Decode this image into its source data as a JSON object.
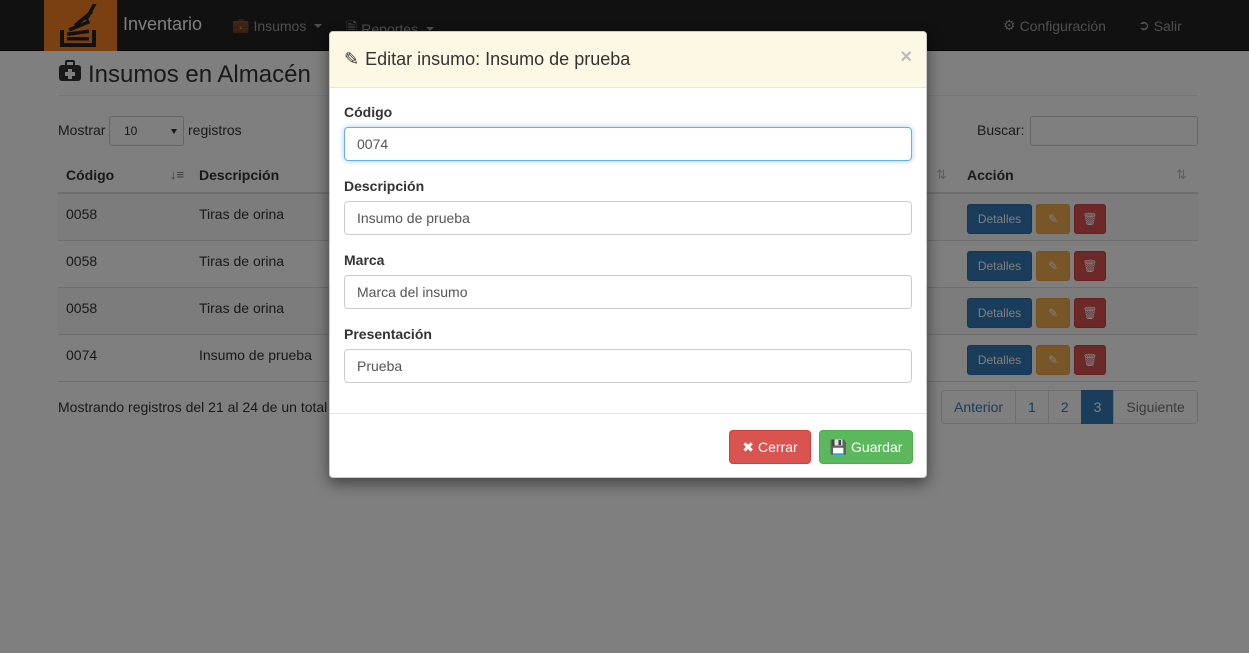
{
  "navbar": {
    "brand": "Inventario",
    "menu": [
      {
        "label": "Insumos"
      },
      {
        "label": "Reportes"
      }
    ],
    "right": [
      {
        "label": "Configuración"
      },
      {
        "label": "Salir"
      }
    ]
  },
  "page": {
    "title": "Insumos en Almacén",
    "show_label": "Mostrar",
    "page_size": "10",
    "records_label": "registros",
    "search_label": "Buscar:",
    "table": {
      "headers": [
        "Código",
        "Descripción",
        "Acción"
      ],
      "rows": [
        {
          "codigo": "0058",
          "descripcion": "Tiras de orina"
        },
        {
          "codigo": "0058",
          "descripcion": "Tiras de orina"
        },
        {
          "codigo": "0058",
          "descripcion": "Tiras de orina"
        },
        {
          "codigo": "0074",
          "descripcion": "Insumo de prueba"
        }
      ],
      "details_label": "Detalles"
    },
    "info": "Mostrando registros del 21 al 24 de un total",
    "pagination": [
      "Anterior",
      "1",
      "2",
      "3",
      "Siguiente"
    ]
  },
  "modal": {
    "title": "Editar insumo: Insumo de prueba",
    "close_glyph": "×",
    "fields": {
      "codigo": {
        "label": "Código",
        "value": "0074"
      },
      "descripcion": {
        "label": "Descripción",
        "value": "Insumo de prueba"
      },
      "marca": {
        "label": "Marca",
        "value": "Marca del insumo"
      },
      "presentacion": {
        "label": "Presentación",
        "value": "Prueba"
      }
    },
    "close_button": "Cerrar",
    "save_button": "Guardar"
  },
  "colors": {
    "navbar": "#222222",
    "logo": "#f48024",
    "modal_header": "#fcf8e3",
    "primary": "#337ab7",
    "warning": "#f0ad4e",
    "danger": "#d9534f",
    "success": "#5cb85c"
  }
}
